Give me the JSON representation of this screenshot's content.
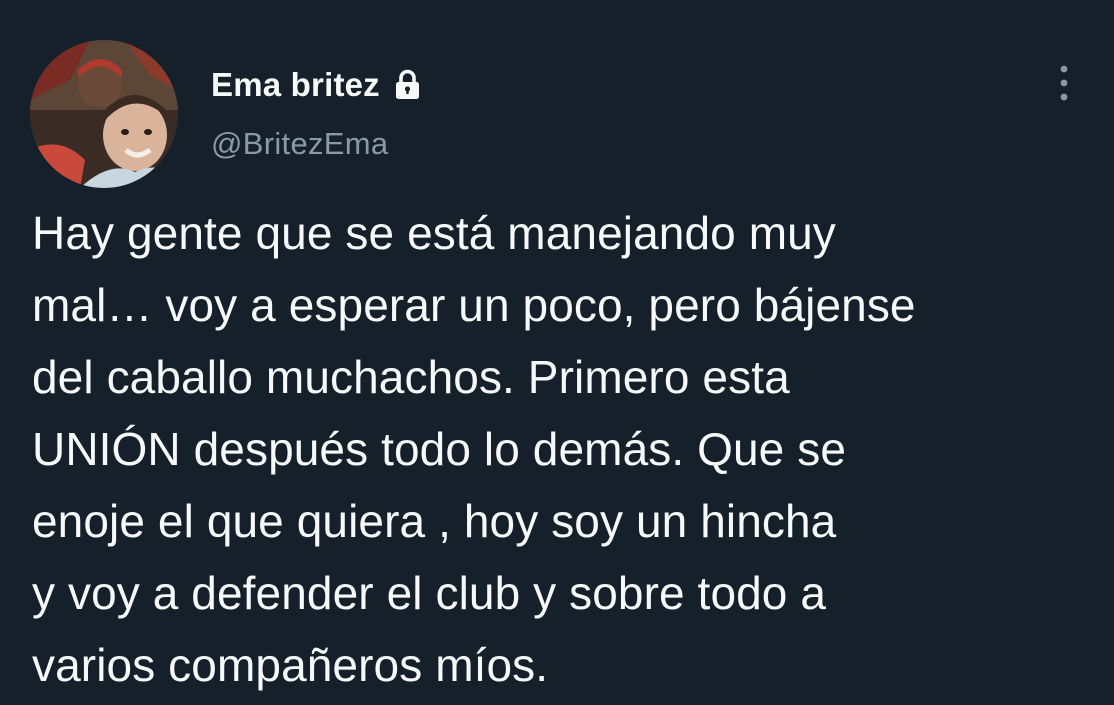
{
  "author": {
    "display_name": "Ema britez",
    "handle": "@BritezEma",
    "avatar_icon": "profile-photo",
    "lock_icon": "lock-icon",
    "protected": true
  },
  "menu": {
    "icon": "more-vertical-icon"
  },
  "tweet": {
    "text": "Hay gente que se está manejando muy\nmal… voy a esperar un poco, pero bájense\ndel caballo muchachos. Primero esta\nUNIÓN después todo lo demás.  Que se\nenoje el que quiera , hoy soy un hincha\ny voy a defender el club y sobre todo a\nvarios compañeros míos."
  },
  "colors": {
    "background": "#15202b",
    "text": "#f7f9f9",
    "secondary_text": "#8b98a5"
  }
}
